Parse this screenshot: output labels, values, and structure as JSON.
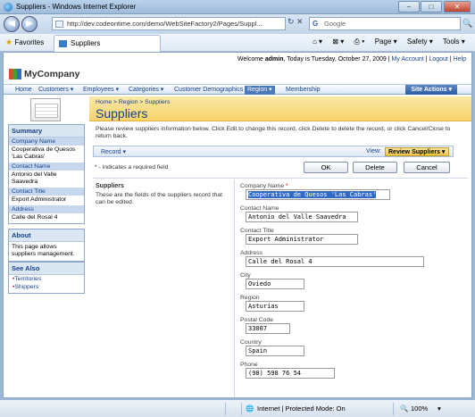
{
  "window": {
    "title": "Suppliers - Windows Internet Explorer",
    "min": "–",
    "max": "□",
    "close": "✕"
  },
  "address": {
    "url": "http://dev.codeontime.com/demo/WebSiteFactory2/Pages/Suppl...",
    "refresh": "↻ ✕",
    "search_placeholder": "Google",
    "search_go": "🔍"
  },
  "favorites": {
    "label": "Favorites",
    "tab": "Suppliers",
    "tools": [
      "Page ▾",
      "Safety ▾",
      "Tools ▾"
    ]
  },
  "header": {
    "welcome_prefix": "Welcome ",
    "user": "admin",
    "welcome_mid": ", Today is Tuesday, October 27, 2009 | ",
    "my_account": "My Account",
    "sep1": " | ",
    "logout": "Logout",
    "sep2": " | ",
    "help": "Help",
    "logo": "MyCompany"
  },
  "menu": {
    "items": [
      "Home",
      "Customers ▾",
      "Employees ▾",
      "Categories ▾",
      "Customer Demographics",
      "Region ▾",
      "Membership"
    ],
    "site_actions": "Site Actions ▾"
  },
  "sidebar": {
    "summary_title": "Summary",
    "fields": [
      {
        "label": "Company Name",
        "value": "Cooperativa de Quesos 'Las Cabras'"
      },
      {
        "label": "Contact Name",
        "value": "Antonio del Valle Saavedra"
      },
      {
        "label": "Contact Title",
        "value": "Export Administrator"
      },
      {
        "label": "Address",
        "value": "Calle del Rosal 4"
      }
    ],
    "about_title": "About",
    "about_text": "This page allows suppliers management.",
    "see_also_title": "See Also",
    "links": [
      "Territories",
      "Shippers"
    ]
  },
  "main": {
    "breadcrumb": "Home  >  Region  >  Suppliers",
    "title": "Suppliers",
    "description": "Please review suppliers information below. Click Edit to change this record, click Delete to delete the record, or click Cancel/Close to return back.",
    "record_menu": "Record ▾",
    "view_label": "View:",
    "view_value": "Review Suppliers ▾",
    "required_note": "* - indicates a required field",
    "buttons": {
      "ok": "OK",
      "delete": "Delete",
      "cancel": "Cancel"
    },
    "section_title": "Suppliers",
    "section_text": "These are the fields of the suppliers record that can be edited.",
    "form": [
      {
        "label": "Company Name",
        "required": "*",
        "value": "Cooperativa de Quesos 'Las Cabras'"
      },
      {
        "label": "Contact Name",
        "required": "",
        "value": "Antonio del Valle Saavedra"
      },
      {
        "label": "Contact Title",
        "required": "",
        "value": "Export Administrator"
      },
      {
        "label": "Address",
        "required": "",
        "value": "Calle del Rosal 4"
      },
      {
        "label": "City",
        "required": "",
        "value": "Oviedo"
      },
      {
        "label": "Region",
        "required": "",
        "value": "Asturias"
      },
      {
        "label": "Postal Code",
        "required": "",
        "value": "33007"
      },
      {
        "label": "Country",
        "required": "",
        "value": "Spain"
      },
      {
        "label": "Phone",
        "required": "",
        "value": "(98) 598 76 54"
      }
    ]
  },
  "status": {
    "zone": "Internet | Protected Mode: On",
    "zoom": "100%"
  }
}
